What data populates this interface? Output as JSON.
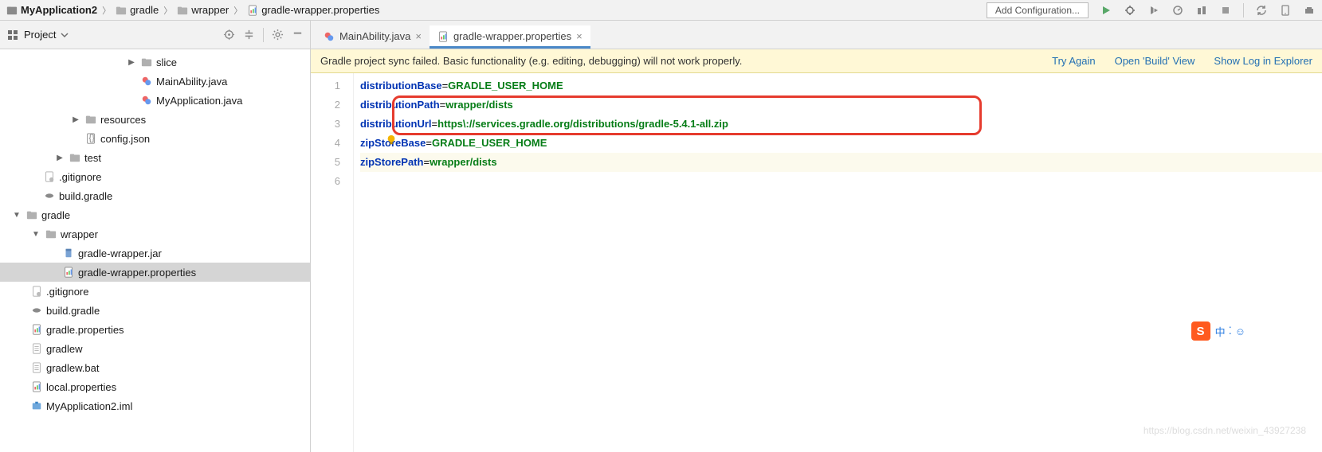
{
  "breadcrumb": {
    "root": "MyApplication2",
    "p1": "gradle",
    "p2": "wrapper",
    "p3": "gradle-wrapper.properties"
  },
  "top": {
    "config": "Add Configuration..."
  },
  "sidebar": {
    "title": "Project",
    "tree": {
      "slice": "slice",
      "mainAbility": "MainAbility.java",
      "myApplication": "MyApplication.java",
      "resources": "resources",
      "configJson": "config.json",
      "test": "test",
      "gitignore1": ".gitignore",
      "buildGradle1": "build.gradle",
      "gradle": "gradle",
      "wrapper": "wrapper",
      "wrapperJar": "gradle-wrapper.jar",
      "wrapperProps": "gradle-wrapper.properties",
      "gitignore2": ".gitignore",
      "buildGradle2": "build.gradle",
      "gradleProps": "gradle.properties",
      "gradlew": "gradlew",
      "gradlewBat": "gradlew.bat",
      "localProps": "local.properties",
      "iml": "MyApplication2.iml"
    }
  },
  "tabs": {
    "t1": "MainAbility.java",
    "t2": "gradle-wrapper.properties"
  },
  "banner": {
    "msg": "Gradle project sync failed. Basic functionality (e.g. editing, debugging) will not work properly.",
    "tryAgain": "Try Again",
    "openBuild": "Open 'Build' View",
    "showLog": "Show Log in Explorer"
  },
  "code": {
    "l1k": "distributionBase",
    "l1v": "GRADLE_USER_HOME",
    "l2k": "distributionPath",
    "l2v": "wrapper/dists",
    "l3k": "distributionUrl",
    "l3v": "https\\://services.gradle.org/distributions/gradle-5.4.1-all.zip",
    "l4k": "zipStoreBase",
    "l4v": "GRADLE_USER_HOME",
    "l5k": "zipStorePath",
    "l5v": "wrapper/dists",
    "ln1": "1",
    "ln2": "2",
    "ln3": "3",
    "ln4": "4",
    "ln5": "5",
    "ln6": "6"
  },
  "ime": {
    "s": "S",
    "lang": "中",
    "dots": "⁚",
    "smile": "☺"
  },
  "watermark": "https://blog.csdn.net/weixin_43927238"
}
